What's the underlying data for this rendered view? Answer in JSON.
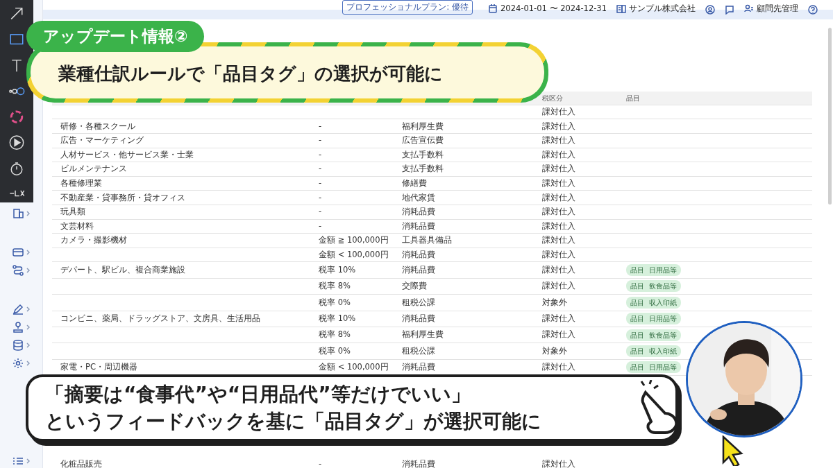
{
  "header": {
    "plan_badge": "プロフェッショナルプラン: 優待",
    "date_range": "2024-01-01 〜 2024-12-31",
    "company": "サンプル株式会社",
    "client_management": "顧問先管理"
  },
  "table": {
    "column_headers": {
      "tax_category": "税区分",
      "item": "品目"
    },
    "rows": [
      {
        "tax_category": "課対仕入"
      },
      {
        "industry": "研修・各種スクール",
        "condition": "-",
        "account": "福利厚生費",
        "tax_category": "課対仕入"
      },
      {
        "industry": "広告・マーケティング",
        "condition": "-",
        "account": "広告宣伝費",
        "tax_category": "課対仕入"
      },
      {
        "industry": "人材サービス・他サービス業・士業",
        "condition": "-",
        "account": "支払手数料",
        "tax_category": "課対仕入"
      },
      {
        "industry": "ビルメンテナンス",
        "condition": "-",
        "account": "支払手数料",
        "tax_category": "課対仕入"
      },
      {
        "industry": "各種修理業",
        "condition": "-",
        "account": "修繕費",
        "tax_category": "課対仕入"
      },
      {
        "industry": "不動産業・貸事務所・貸オフィス",
        "condition": "-",
        "account": "地代家賃",
        "tax_category": "課対仕入"
      },
      {
        "industry": "玩具類",
        "condition": "-",
        "account": "消耗品費",
        "tax_category": "課対仕入"
      },
      {
        "industry": "文芸材料",
        "condition": "-",
        "account": "消耗品費",
        "tax_category": "課対仕入"
      },
      {
        "industry": "カメラ・撮影機材",
        "condition": "金額 ≧ 100,000円",
        "account": "工具器具備品",
        "tax_category": "課対仕入"
      },
      {
        "condition": "金額 < 100,000円",
        "account": "消耗品費",
        "tax_category": "課対仕入"
      },
      {
        "industry": "デパート、駅ビル、複合商業施設",
        "condition": "税率 10%",
        "account": "消耗品費",
        "tax_category": "課対仕入",
        "tag": {
          "label": "品目",
          "value": "日用品等"
        }
      },
      {
        "condition": "税率 8%",
        "account": "交際費",
        "tax_category": "課対仕入",
        "tag": {
          "label": "品目",
          "value": "飲食品等"
        }
      },
      {
        "condition": "税率 0%",
        "account": "租税公課",
        "tax_category": "対象外",
        "tag": {
          "label": "品目",
          "value": "収入印紙"
        }
      },
      {
        "industry": "コンビニ、薬局、ドラッグストア、文房具、生活用品",
        "condition": "税率 10%",
        "account": "消耗品費",
        "tax_category": "課対仕入",
        "tag": {
          "label": "品目",
          "value": "日用品等"
        }
      },
      {
        "condition": "税率 8%",
        "account": "福利厚生費",
        "tax_category": "課対仕入",
        "tag": {
          "label": "品目",
          "value": "飲食品等"
        }
      },
      {
        "condition": "税率 0%",
        "account": "租税公課",
        "tax_category": "対象外",
        "tag": {
          "label": "品目",
          "value": "収入印紙"
        }
      },
      {
        "industry": "家電・PC・周辺機器",
        "condition": "金額 < 100,000円",
        "account": "消耗品費",
        "tax_category": "課対仕入",
        "tag": {
          "label": "品目",
          "value": "日用品等"
        }
      }
    ],
    "last_row": {
      "industry": "化粧品販売",
      "condition": "-",
      "account": "消耗品費",
      "tax_category": "課対仕入"
    }
  },
  "banner": {
    "label": "アップデート情報②",
    "text": "業種仕訳ルールで「品目タグ」の選択が可能に"
  },
  "caption": {
    "lines": [
      "「摘要は“食事代”や“日用品代”等だけでいい」",
      "というフィードバックを基に「品目タグ」が選択可能に"
    ]
  }
}
